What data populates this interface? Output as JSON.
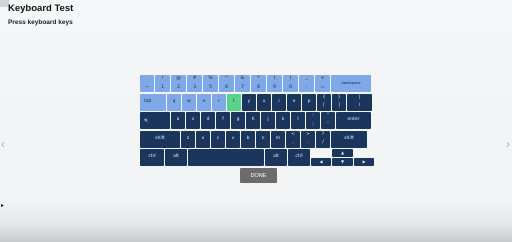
{
  "header": {
    "title": "Keyboard Test",
    "subtitle": "Press keyboard keys"
  },
  "nav": {
    "left_glyph": "‹",
    "right_glyph": "›",
    "cursor_glyph": "▸"
  },
  "colors": {
    "key_dark": "#1b365d",
    "key_light": "#7fa8e6",
    "key_pressed": "#59d28b",
    "done_button": "#6c6c6c"
  },
  "keyboard": {
    "row1": [
      {
        "top": "",
        "bot": "~"
      },
      {
        "top": "!",
        "bot": "1"
      },
      {
        "top": "@",
        "bot": "2"
      },
      {
        "top": "#",
        "bot": "3"
      },
      {
        "top": "%",
        "bot": "5"
      },
      {
        "top": "^",
        "bot": "6"
      },
      {
        "top": "&",
        "bot": "7"
      },
      {
        "top": "*",
        "bot": "8"
      },
      {
        "top": "(",
        "bot": "9"
      },
      {
        "top": ")",
        "bot": "0"
      },
      {
        "top": "_",
        "bot": "-"
      },
      {
        "top": "+",
        "bot": "="
      },
      {
        "top": "",
        "bot": "backspace"
      }
    ],
    "row2": [
      {
        "top": "",
        "bot": "tab"
      },
      {
        "top": "",
        "bot": "q"
      },
      {
        "top": "",
        "bot": "w"
      },
      {
        "top": "",
        "bot": "e"
      },
      {
        "top": "",
        "bot": "r"
      },
      {
        "top": "",
        "bot": "t"
      },
      {
        "top": "",
        "bot": "y"
      },
      {
        "top": "",
        "bot": "u"
      },
      {
        "top": "",
        "bot": "i"
      },
      {
        "top": "",
        "bot": "o"
      },
      {
        "top": "",
        "bot": "p"
      },
      {
        "top": "{",
        "bot": "["
      },
      {
        "top": "}",
        "bot": "]"
      },
      {
        "top": "|",
        "bot": "\\"
      }
    ],
    "row3": [
      {
        "top": "",
        "bot": "🔍"
      },
      {
        "top": "",
        "bot": "a"
      },
      {
        "top": "",
        "bot": "s"
      },
      {
        "top": "",
        "bot": "d"
      },
      {
        "top": "",
        "bot": "f"
      },
      {
        "top": "",
        "bot": "g"
      },
      {
        "top": "",
        "bot": "h"
      },
      {
        "top": "",
        "bot": "j"
      },
      {
        "top": "",
        "bot": "k"
      },
      {
        "top": "",
        "bot": "l"
      },
      {
        "top": ":",
        "bot": ";"
      },
      {
        "top": "\"",
        "bot": "'"
      },
      {
        "top": "",
        "bot": "enter"
      }
    ],
    "row4": [
      {
        "top": "",
        "bot": "shift"
      },
      {
        "top": "",
        "bot": "z"
      },
      {
        "top": "",
        "bot": "x"
      },
      {
        "top": "",
        "bot": "c"
      },
      {
        "top": "",
        "bot": "v"
      },
      {
        "top": "",
        "bot": "b"
      },
      {
        "top": "",
        "bot": "n"
      },
      {
        "top": "",
        "bot": "m"
      },
      {
        "top": "<",
        "bot": ","
      },
      {
        "top": ">",
        "bot": "."
      },
      {
        "top": "?",
        "bot": "/"
      },
      {
        "top": "",
        "bot": "shift"
      }
    ],
    "row5": [
      {
        "top": "",
        "bot": "ctrl"
      },
      {
        "top": "",
        "bot": "alt"
      },
      {
        "top": "",
        "bot": ""
      },
      {
        "top": "",
        "bot": "alt"
      },
      {
        "top": "",
        "bot": "ctrl"
      }
    ],
    "arrows": {
      "up": "▲",
      "left": "◀",
      "down": "▼",
      "right": "▶"
    }
  },
  "done_button": {
    "label": "DONE"
  }
}
